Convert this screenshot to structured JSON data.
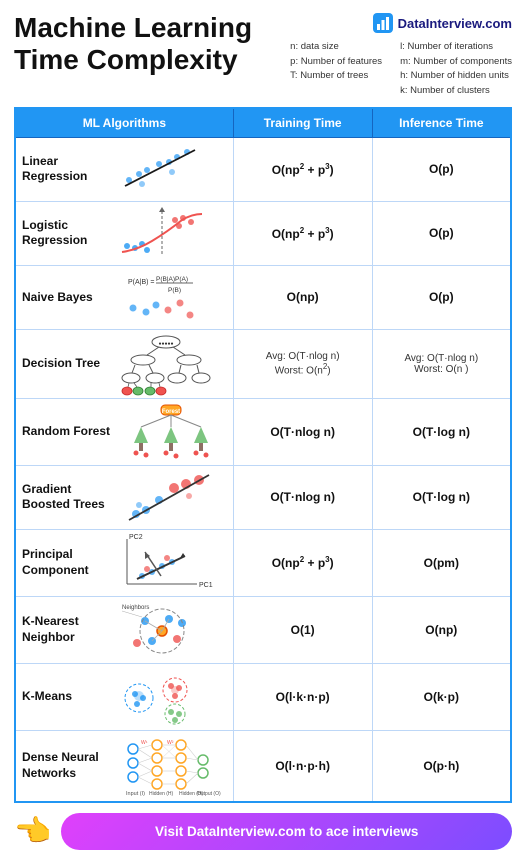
{
  "title": "Machine Learning\nTime Complexity",
  "brand": {
    "name": "DataInterview.com",
    "icon_color": "#2196f3"
  },
  "legend": {
    "left": [
      "n: data size",
      "p: Number of features",
      "T: Number of trees"
    ],
    "right": [
      "l: Number of iterations",
      "m: Number of components",
      "h: Number of hidden units",
      "k: Number of clusters"
    ]
  },
  "table": {
    "headers": [
      "ML Algorithms",
      "Training Time",
      "Inference Time"
    ],
    "rows": [
      {
        "name": "Linear\nRegression",
        "training": "O(np² + p³)",
        "inference": "O(p)"
      },
      {
        "name": "Logistic\nRegression",
        "training": "O(np² + p³)",
        "inference": "O(p)"
      },
      {
        "name": "Naive Bayes",
        "training": "O(np)",
        "inference": "O(p)"
      },
      {
        "name": "Decision Tree",
        "training": "Avg: O(T·nlog n)\nWorst: O(n²)",
        "inference": "Avg: O(T·nlog n)\nWorst: O(n )"
      },
      {
        "name": "Random Forest",
        "training": "O(T·nlog n)",
        "inference": "O(T·log n)"
      },
      {
        "name": "Gradient\nBoosted Trees",
        "training": "O(T·nlog n)",
        "inference": "O(T·log n)"
      },
      {
        "name": "Principal\nComponent",
        "training": "O(np² + p³)",
        "inference": "O(pm)"
      },
      {
        "name": "K-Nearest\nNeighbor",
        "training": "O(1)",
        "inference": "O(np)"
      },
      {
        "name": "K-Means",
        "training": "O(l·k·n·p)",
        "inference": "O(k·p)"
      },
      {
        "name": "Dense Neural\nNetworks",
        "training": "O(l·n·p·h)",
        "inference": "O(p·h)"
      }
    ]
  },
  "cta": {
    "label": "Visit DataInterview.com to ace interviews"
  }
}
